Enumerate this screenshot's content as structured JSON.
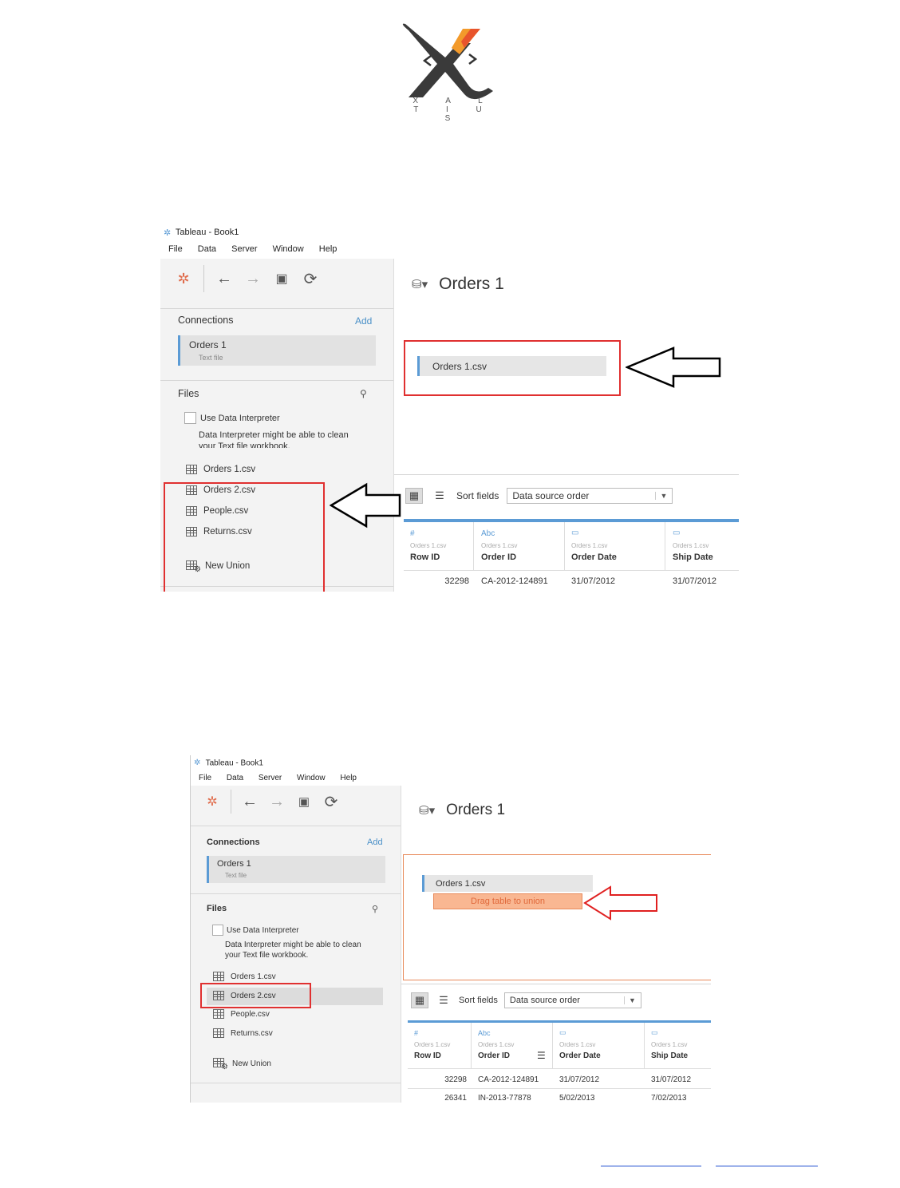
{
  "logo": {
    "text": "X A L T I U S"
  },
  "shot1": {
    "window_title": "Tableau - Book1",
    "menu": [
      "File",
      "Data",
      "Server",
      "Window",
      "Help"
    ],
    "connections_title": "Connections",
    "add_label": "Add",
    "connection": {
      "name": "Orders 1",
      "type": "Text file"
    },
    "files_title": "Files",
    "use_interpreter": "Use Data Interpreter",
    "interpreter_note_1": "Data Interpreter might be able to clean",
    "interpreter_note_2": "your Text file workbook.",
    "files": [
      "Orders 1.csv",
      "Orders 2.csv",
      "People.csv",
      "Returns.csv"
    ],
    "new_union": "New Union",
    "datasource_title": "Orders 1",
    "canvas_table": "Orders 1.csv",
    "sort_fields_label": "Sort fields",
    "sort_fields_value": "Data source order",
    "columns": [
      {
        "type": "#",
        "source": "Orders 1.csv",
        "name": "Row ID"
      },
      {
        "type": "Abc",
        "source": "Orders 1.csv",
        "name": "Order ID"
      },
      {
        "type": "date",
        "source": "Orders 1.csv",
        "name": "Order Date"
      },
      {
        "type": "date",
        "source": "Orders 1.csv",
        "name": "Ship Date"
      }
    ],
    "rows": [
      [
        "32298",
        "CA-2012-124891",
        "31/07/2012",
        "31/07/2012"
      ]
    ]
  },
  "shot2": {
    "window_title": "Tableau - Book1",
    "menu": [
      "File",
      "Data",
      "Server",
      "Window",
      "Help"
    ],
    "connections_title": "Connections",
    "add_label": "Add",
    "connection": {
      "name": "Orders 1",
      "type": "Text file"
    },
    "files_title": "Files",
    "use_interpreter": "Use Data Interpreter",
    "interpreter_note_1": "Data Interpreter might be able to clean",
    "interpreter_note_2": "your Text file workbook.",
    "files": [
      "Orders 1.csv",
      "Orders 2.csv",
      "People.csv",
      "Returns.csv"
    ],
    "new_union": "New Union",
    "datasource_title": "Orders 1",
    "canvas_table": "Orders 1.csv",
    "drag_hint": "Drag table to union",
    "sort_fields_label": "Sort fields",
    "sort_fields_value": "Data source order",
    "columns": [
      {
        "type": "#",
        "source": "Orders 1.csv",
        "name": "Row ID"
      },
      {
        "type": "Abc",
        "source": "Orders 1.csv",
        "name": "Order ID"
      },
      {
        "type": "date",
        "source": "Orders 1.csv",
        "name": "Order Date"
      },
      {
        "type": "date",
        "source": "Orders 1.csv",
        "name": "Ship Date"
      }
    ],
    "rows": [
      [
        "32298",
        "CA-2012-124891",
        "31/07/2012",
        "31/07/2012"
      ],
      [
        "26341",
        "IN-2013-77878",
        "5/02/2013",
        "7/02/2013"
      ]
    ]
  },
  "colors": {
    "highlight_red": "#e03030",
    "accent_blue": "#5b9bd5",
    "union_orange": "#f9b792"
  }
}
